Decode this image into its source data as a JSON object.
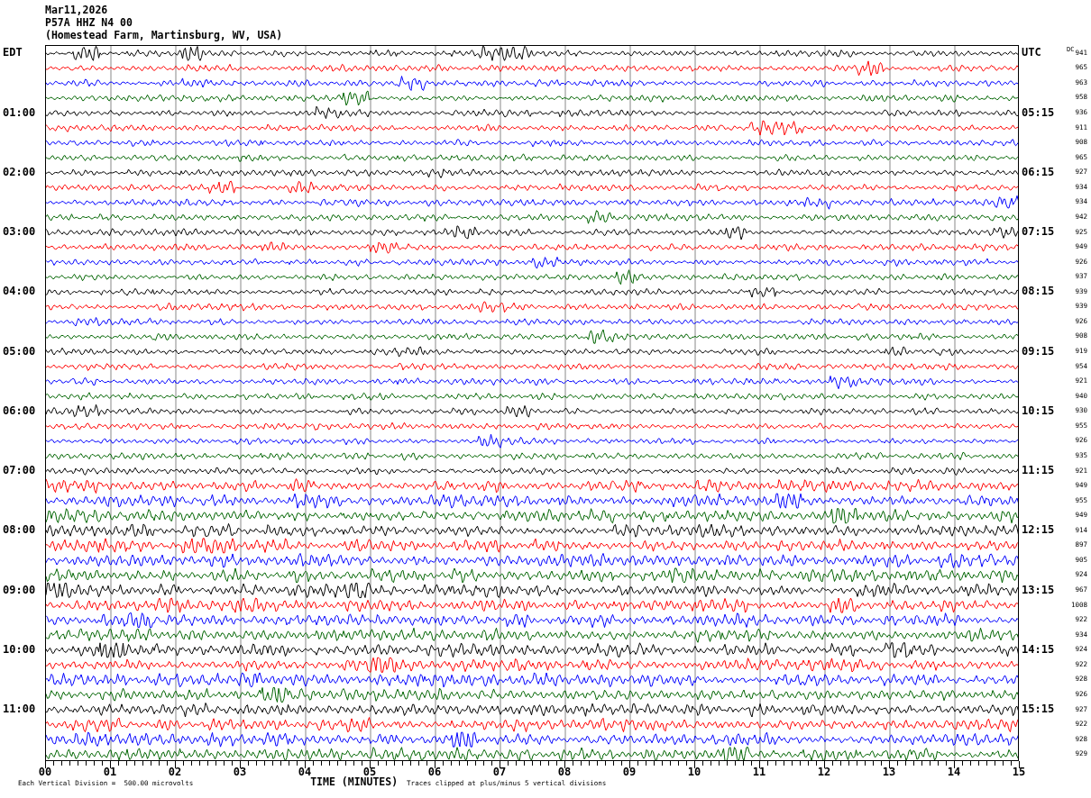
{
  "header": {
    "date": "Mar11,2026",
    "station": "P57A HHZ N4 00",
    "location": "(Homestead Farm, Martinsburg, WV, USA)"
  },
  "left_heading": "EDT",
  "right_heading": "UTC",
  "dc_heading": "DC",
  "hours": [
    {
      "edt": "01:00",
      "utc": "05:15"
    },
    {
      "edt": "02:00",
      "utc": "06:15"
    },
    {
      "edt": "03:00",
      "utc": "07:15"
    },
    {
      "edt": "04:00",
      "utc": "08:15"
    },
    {
      "edt": "05:00",
      "utc": "09:15"
    },
    {
      "edt": "06:00",
      "utc": "10:15"
    },
    {
      "edt": "07:00",
      "utc": "11:15"
    },
    {
      "edt": "08:00",
      "utc": "12:15"
    },
    {
      "edt": "09:00",
      "utc": "13:15"
    },
    {
      "edt": "10:00",
      "utc": "14:15"
    },
    {
      "edt": "11:00",
      "utc": "15:15"
    }
  ],
  "traces": [
    {
      "dc": "941",
      "color": "#000000"
    },
    {
      "dc": "965",
      "color": "#ff0000"
    },
    {
      "dc": "963",
      "color": "#0000ff"
    },
    {
      "dc": "958",
      "color": "#006400"
    },
    {
      "dc": "936",
      "color": "#000000"
    },
    {
      "dc": "911",
      "color": "#ff0000"
    },
    {
      "dc": "908",
      "color": "#0000ff"
    },
    {
      "dc": "965",
      "color": "#006400"
    },
    {
      "dc": "927",
      "color": "#000000"
    },
    {
      "dc": "934",
      "color": "#ff0000"
    },
    {
      "dc": "934",
      "color": "#0000ff"
    },
    {
      "dc": "942",
      "color": "#006400"
    },
    {
      "dc": "925",
      "color": "#000000"
    },
    {
      "dc": "949",
      "color": "#ff0000"
    },
    {
      "dc": "926",
      "color": "#0000ff"
    },
    {
      "dc": "937",
      "color": "#006400"
    },
    {
      "dc": "939",
      "color": "#000000"
    },
    {
      "dc": "939",
      "color": "#ff0000"
    },
    {
      "dc": "926",
      "color": "#0000ff"
    },
    {
      "dc": "908",
      "color": "#006400"
    },
    {
      "dc": "919",
      "color": "#000000"
    },
    {
      "dc": "954",
      "color": "#ff0000"
    },
    {
      "dc": "921",
      "color": "#0000ff"
    },
    {
      "dc": "940",
      "color": "#006400"
    },
    {
      "dc": "930",
      "color": "#000000"
    },
    {
      "dc": "955",
      "color": "#ff0000"
    },
    {
      "dc": "926",
      "color": "#0000ff"
    },
    {
      "dc": "935",
      "color": "#006400"
    },
    {
      "dc": "921",
      "color": "#000000"
    },
    {
      "dc": "949",
      "color": "#ff0000"
    },
    {
      "dc": "955",
      "color": "#0000ff"
    },
    {
      "dc": "949",
      "color": "#006400"
    },
    {
      "dc": "914",
      "color": "#000000"
    },
    {
      "dc": "897",
      "color": "#ff0000"
    },
    {
      "dc": "905",
      "color": "#0000ff"
    },
    {
      "dc": "924",
      "color": "#006400"
    },
    {
      "dc": "967",
      "color": "#000000"
    },
    {
      "dc": "1008",
      "color": "#ff0000"
    },
    {
      "dc": "922",
      "color": "#0000ff"
    },
    {
      "dc": "934",
      "color": "#006400"
    },
    {
      "dc": "924",
      "color": "#000000"
    },
    {
      "dc": "922",
      "color": "#ff0000"
    },
    {
      "dc": "928",
      "color": "#0000ff"
    },
    {
      "dc": "926",
      "color": "#006400"
    },
    {
      "dc": "927",
      "color": "#000000"
    },
    {
      "dc": "922",
      "color": "#ff0000"
    },
    {
      "dc": "928",
      "color": "#0000ff"
    },
    {
      "dc": "929",
      "color": "#006400"
    }
  ],
  "x_axis": {
    "labels": [
      "00",
      "01",
      "02",
      "03",
      "04",
      "05",
      "06",
      "07",
      "08",
      "09",
      "10",
      "11",
      "12",
      "13",
      "14",
      "15"
    ],
    "title": "TIME (MINUTES)"
  },
  "scale_note": "Each Vertical Division =  500.00 microvolts",
  "clip_note": "Traces clipped at plus/minus 5 vertical divisions"
}
